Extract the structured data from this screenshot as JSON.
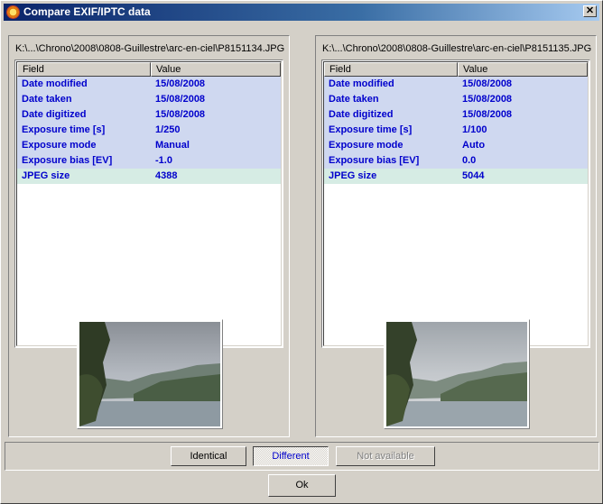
{
  "window": {
    "title": "Compare EXIF/IPTC data",
    "close_label": "✕"
  },
  "left": {
    "path": "K:\\...\\Chrono\\2008\\0808-Guillestre\\arc-en-ciel\\P8151134.JPG",
    "header": {
      "field": "Field",
      "value": "Value"
    },
    "rows": [
      {
        "field": "Date modified",
        "value": "15/08/2008"
      },
      {
        "field": "Date taken",
        "value": "15/08/2008"
      },
      {
        "field": "Date digitized",
        "value": "15/08/2008"
      },
      {
        "field": "Exposure time [s]",
        "value": "1/250"
      },
      {
        "field": "Exposure mode",
        "value": "Manual"
      },
      {
        "field": "Exposure bias [EV]",
        "value": "-1.0"
      },
      {
        "field": "JPEG size",
        "value": "4388"
      }
    ]
  },
  "right": {
    "path": "K:\\...\\Chrono\\2008\\0808-Guillestre\\arc-en-ciel\\P8151135.JPG",
    "header": {
      "field": "Field",
      "value": "Value"
    },
    "rows": [
      {
        "field": "Date modified",
        "value": "15/08/2008"
      },
      {
        "field": "Date taken",
        "value": "15/08/2008"
      },
      {
        "field": "Date digitized",
        "value": "15/08/2008"
      },
      {
        "field": "Exposure time [s]",
        "value": "1/100"
      },
      {
        "field": "Exposure mode",
        "value": "Auto"
      },
      {
        "field": "Exposure bias [EV]",
        "value": "0.0"
      },
      {
        "field": "JPEG size",
        "value": "5044"
      }
    ]
  },
  "legend": {
    "identical": "Identical",
    "different": "Different",
    "not_available": "Not available"
  },
  "footer": {
    "ok": "Ok"
  }
}
